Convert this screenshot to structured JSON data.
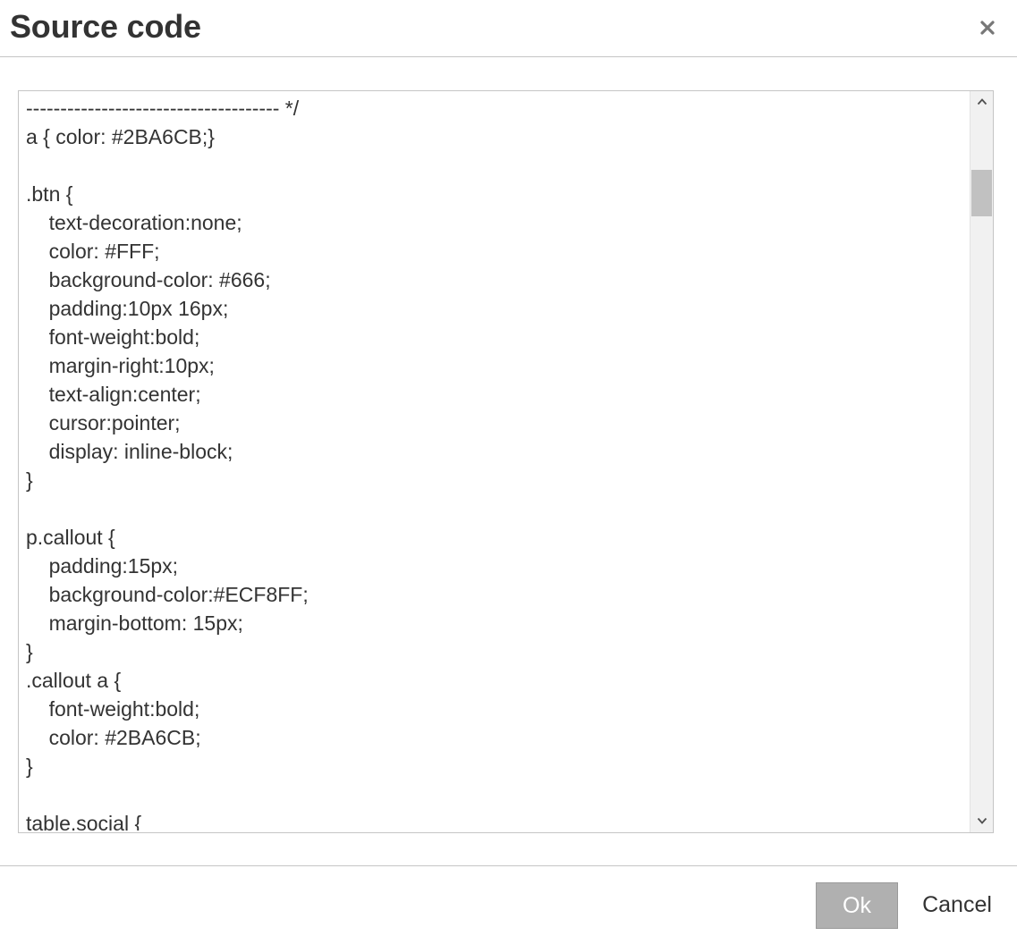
{
  "dialog": {
    "title": "Source code",
    "close_icon": "close-icon"
  },
  "editor": {
    "code_lines": [
      "------------------------------------- */",
      "a { color: #2BA6CB;}",
      "",
      ".btn {",
      "\ttext-decoration:none;",
      "\tcolor: #FFF;",
      "\tbackground-color: #666;",
      "\tpadding:10px 16px;",
      "\tfont-weight:bold;",
      "\tmargin-right:10px;",
      "\ttext-align:center;",
      "\tcursor:pointer;",
      "\tdisplay: inline-block;",
      "}",
      "",
      "p.callout {",
      "\tpadding:15px;",
      "\tbackground-color:#ECF8FF;",
      "\tmargin-bottom: 15px;",
      "}",
      ".callout a {",
      "\tfont-weight:bold;",
      "\tcolor: #2BA6CB;",
      "}",
      "",
      "table.social {"
    ],
    "scroll_up_icon": "chevron-up-icon",
    "scroll_down_icon": "chevron-down-icon"
  },
  "footer": {
    "ok_label": "Ok",
    "cancel_label": "Cancel"
  },
  "colors": {
    "ok_button_bg": "#b0b0b0",
    "text": "#333333",
    "border": "#c5c5c5"
  }
}
